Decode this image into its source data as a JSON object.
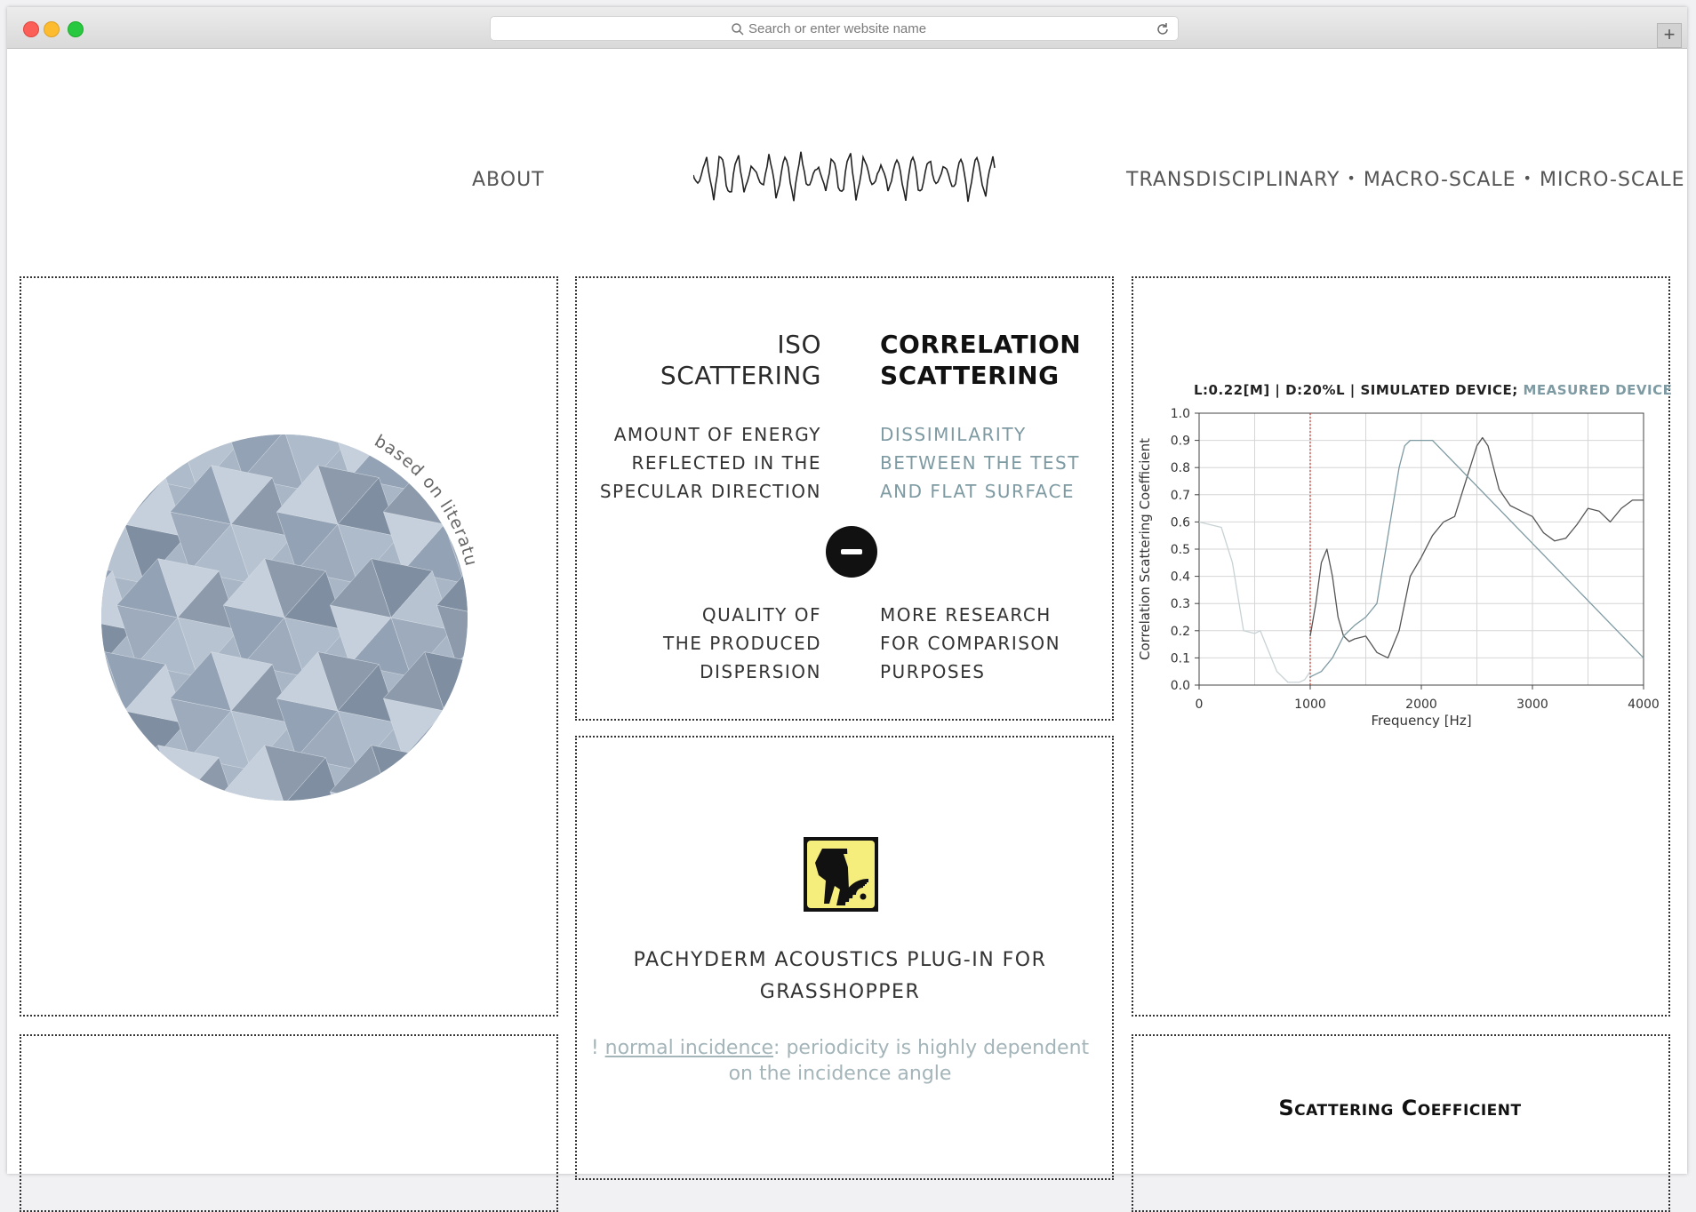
{
  "browser": {
    "address_placeholder": "Search or enter website name",
    "new_tab_label": "+"
  },
  "header": {
    "about": "ABOUT",
    "nav_items": [
      "TRANSDISCIPLINARY",
      "MACRO-SCALE",
      "MICRO-SCALE"
    ],
    "separator": "•"
  },
  "left_panel": {
    "image_caption": "based on literature",
    "image_icon": "faceted-triangle-surface"
  },
  "comparison": {
    "iso_heading": [
      "ISO",
      "SCATTERING"
    ],
    "corr_heading": [
      "CORRELATION",
      "SCATTERING"
    ],
    "iso_def": [
      "AMOUNT OF ENERGY",
      "REFLECTED IN THE",
      "SPECULAR DIRECTION"
    ],
    "corr_def": [
      "DISSIMILARITY",
      "BETWEEN THE TEST",
      "AND FLAT SURFACE"
    ],
    "iso_quality": [
      "QUALITY OF",
      "THE PRODUCED",
      "DISPERSION"
    ],
    "corr_quality": [
      "MORE RESEARCH",
      "FOR COMPARISON",
      "PURPOSES"
    ],
    "accent_color": "#7e9aa2"
  },
  "plugin": {
    "logo_icon": "pachyderm-elephant-icon",
    "title_line1": "PACHYDERM ACOUSTICS PLUG-IN FOR",
    "title_line2": "GRASSHOPPER",
    "note_prefix": "! ",
    "note_link": "normal incidence",
    "note_rest": ": periodicity is highly dependent",
    "note_line2": "on the incidence angle"
  },
  "scattering": {
    "title": "Scattering Coefficient"
  },
  "chart_data": {
    "type": "line",
    "title_main": "L:0.22[M] | D:20%L | ",
    "title_sim": "SIMULATED DEVICE",
    "title_sep": "; ",
    "title_meas": "MEASURED DEVICE",
    "xlabel": "Frequency [Hz]",
    "ylabel": "Correlation Scattering Coefficient",
    "xlim": [
      0,
      4000
    ],
    "ylim": [
      0,
      1.0
    ],
    "x_ticks": [
      "0",
      "1000",
      "2000",
      "3000",
      "4000"
    ],
    "y_ticks": [
      "0.0",
      "0.1",
      "0.2",
      "0.3",
      "0.4",
      "0.5",
      "0.6",
      "0.7",
      "0.8",
      "0.9",
      "1.0"
    ],
    "grid": true,
    "marker_x": 1000,
    "series": [
      {
        "name": "SIMULATED DEVICE",
        "color": "#555555",
        "x": [
          1000,
          1050,
          1100,
          1150,
          1200,
          1250,
          1300,
          1350,
          1400,
          1500,
          1600,
          1700,
          1800,
          1900,
          2000,
          2100,
          2200,
          2300,
          2400,
          2500,
          2550,
          2600,
          2700,
          2800,
          2900,
          3000,
          3100,
          3200,
          3300,
          3400,
          3500,
          3600,
          3700,
          3800,
          3900,
          4000
        ],
        "y": [
          0.18,
          0.3,
          0.45,
          0.5,
          0.4,
          0.25,
          0.18,
          0.16,
          0.17,
          0.18,
          0.12,
          0.1,
          0.2,
          0.4,
          0.47,
          0.55,
          0.6,
          0.62,
          0.75,
          0.88,
          0.91,
          0.88,
          0.72,
          0.66,
          0.64,
          0.62,
          0.56,
          0.53,
          0.54,
          0.59,
          0.65,
          0.64,
          0.6,
          0.65,
          0.68,
          0.68
        ]
      },
      {
        "name": "MEASURED DEVICE",
        "color": "#7e9aa2",
        "x": [
          1000,
          1100,
          1200,
          1300,
          1400,
          1500,
          1600,
          1700,
          1800,
          1850,
          1900,
          1950,
          2000,
          2050,
          2100,
          4000
        ],
        "y": [
          0.03,
          0.05,
          0.1,
          0.18,
          0.22,
          0.25,
          0.3,
          0.55,
          0.8,
          0.88,
          0.9,
          0.9,
          0.9,
          0.9,
          0.9,
          0.1
        ]
      },
      {
        "name": "",
        "color": "#c8d2d4",
        "x": [
          0,
          100,
          200,
          300,
          400,
          500,
          550,
          600,
          700,
          800,
          900,
          950,
          1000
        ],
        "y": [
          0.6,
          0.59,
          0.58,
          0.45,
          0.2,
          0.19,
          0.2,
          0.15,
          0.05,
          0.01,
          0.01,
          0.02,
          0.05
        ]
      }
    ]
  }
}
